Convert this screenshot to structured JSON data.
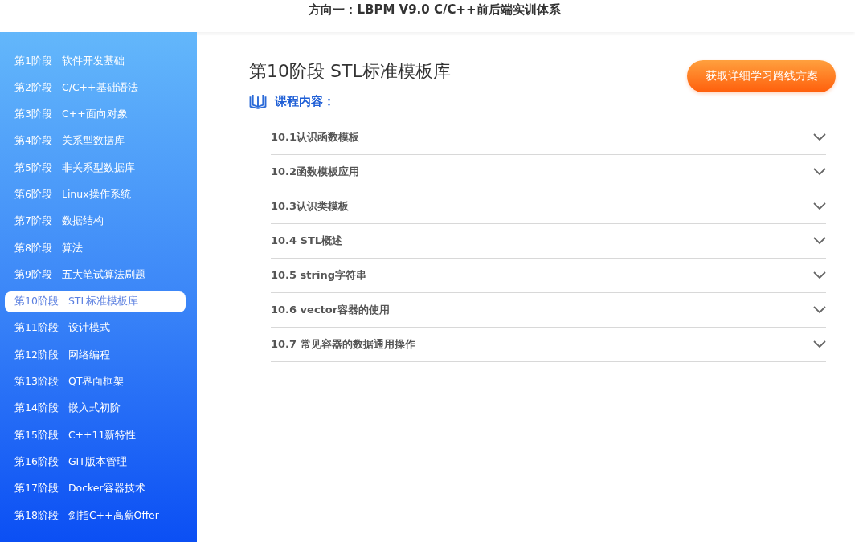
{
  "header": {
    "title": "方向一：LBPM V9.0 C/C++前后端实训体系"
  },
  "sidebar": {
    "items": [
      {
        "stage": "第1阶段",
        "name": "软件开发基础",
        "selected": false
      },
      {
        "stage": "第2阶段",
        "name": "C/C++基础语法",
        "selected": false
      },
      {
        "stage": "第3阶段",
        "name": "C++面向对象",
        "selected": false
      },
      {
        "stage": "第4阶段",
        "name": "关系型数据库",
        "selected": false
      },
      {
        "stage": "第5阶段",
        "name": "非关系型数据库",
        "selected": false
      },
      {
        "stage": "第6阶段",
        "name": "Linux操作系统",
        "selected": false
      },
      {
        "stage": "第7阶段",
        "name": "数据结构",
        "selected": false
      },
      {
        "stage": "第8阶段",
        "name": "算法",
        "selected": false
      },
      {
        "stage": "第9阶段",
        "name": "五大笔试算法刷题",
        "selected": false
      },
      {
        "stage": "第10阶段",
        "name": "STL标准模板库",
        "selected": true
      },
      {
        "stage": "第11阶段",
        "name": "设计模式",
        "selected": false
      },
      {
        "stage": "第12阶段",
        "name": "网络编程",
        "selected": false
      },
      {
        "stage": "第13阶段",
        "name": "QT界面框架",
        "selected": false
      },
      {
        "stage": "第14阶段",
        "name": "嵌入式初阶",
        "selected": false
      },
      {
        "stage": "第15阶段",
        "name": "C++11新特性",
        "selected": false
      },
      {
        "stage": "第16阶段",
        "name": "GIT版本管理",
        "selected": false
      },
      {
        "stage": "第17阶段",
        "name": "Docker容器技术",
        "selected": false
      },
      {
        "stage": "第18阶段",
        "name": "剑指C++高薪Offer",
        "selected": false
      }
    ]
  },
  "main": {
    "title": "第10阶段 STL标准模板库",
    "cta_button": "获取详细学习路线方案",
    "section_heading": "课程内容：",
    "lessons": [
      {
        "title": "10.1认识函数模板",
        "expanded": false
      },
      {
        "title": "10.2函数模板应用",
        "expanded": false
      },
      {
        "title": "10.3认识类模板",
        "expanded": false
      },
      {
        "title": "10.4 STL概述",
        "expanded": false
      },
      {
        "title": "10.5 string字符串",
        "expanded": false
      },
      {
        "title": "10.6 vector容器的使用",
        "expanded": false
      },
      {
        "title": "10.7 常见容器的数据通用操作",
        "expanded": false
      }
    ]
  }
}
